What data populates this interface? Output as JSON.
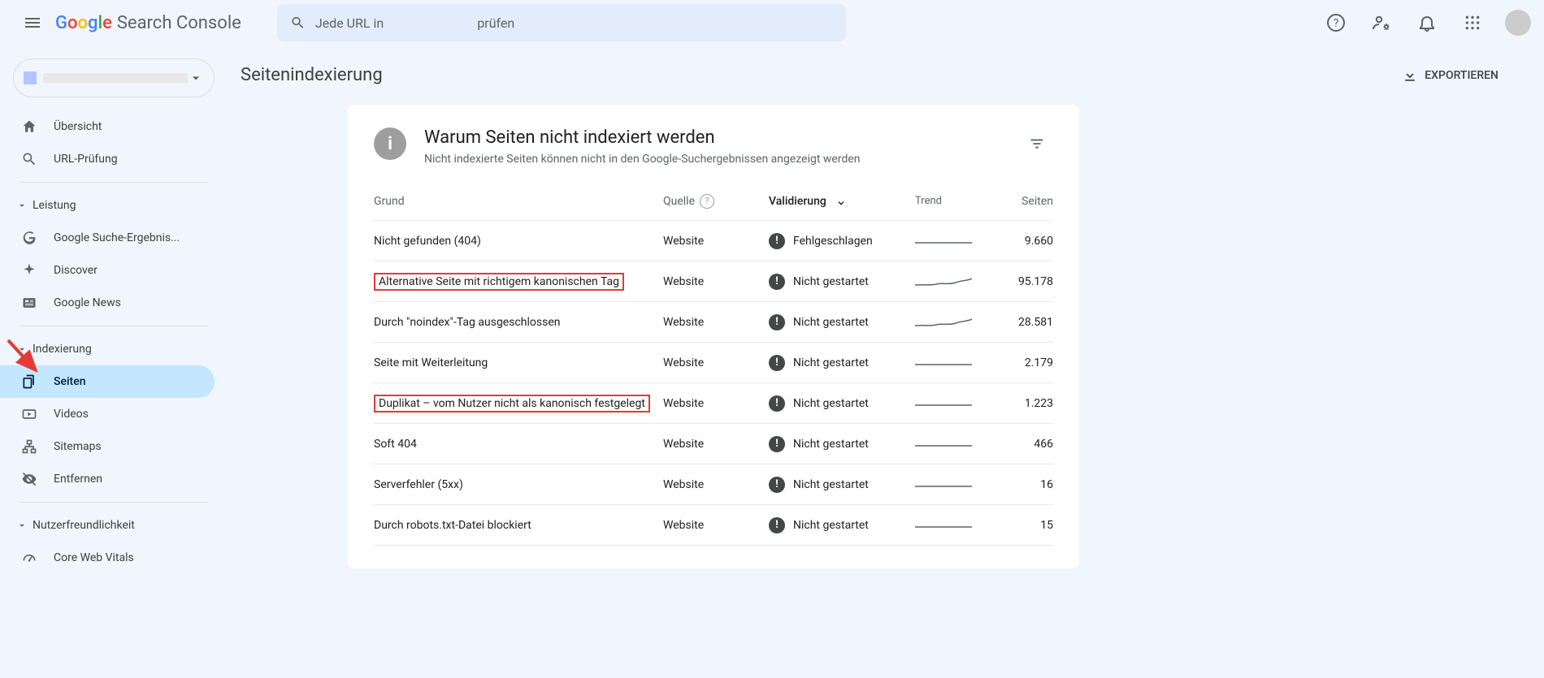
{
  "app": {
    "product_name": "Search Console"
  },
  "search": {
    "prefix": "Jede URL in",
    "suffix": "prüfen"
  },
  "sidebar": {
    "overview": "Übersicht",
    "url_inspection": "URL-Prüfung",
    "section_performance": "Leistung",
    "perf_search": "Google Suche-Ergebnis...",
    "perf_discover": "Discover",
    "perf_news": "Google News",
    "section_indexing": "Indexierung",
    "idx_pages": "Seiten",
    "idx_videos": "Videos",
    "idx_sitemaps": "Sitemaps",
    "idx_remove": "Entfernen",
    "section_ux": "Nutzerfreundlichkeit",
    "ux_cwv": "Core Web Vitals"
  },
  "page": {
    "title": "Seitenindexierung",
    "export": "EXPORTIEREN"
  },
  "card": {
    "title": "Warum Seiten nicht indexiert werden",
    "subtitle": "Nicht indexierte Seiten können nicht in den Google-Suchergebnissen angezeigt werden"
  },
  "table": {
    "head": {
      "reason": "Grund",
      "source": "Quelle",
      "validation": "Validierung",
      "trend": "Trend",
      "pages": "Seiten"
    },
    "rows": [
      {
        "reason": "Nicht gefunden (404)",
        "source": "Website",
        "validation": "Fehlgeschlagen",
        "pages": "9.660",
        "highlight": false,
        "trend": "flat"
      },
      {
        "reason": "Alternative Seite mit richtigem kanonischen Tag",
        "source": "Website",
        "validation": "Nicht gestartet",
        "pages": "95.178",
        "highlight": true,
        "trend": "wavy"
      },
      {
        "reason": "Durch \"noindex\"-Tag ausgeschlossen",
        "source": "Website",
        "validation": "Nicht gestartet",
        "pages": "28.581",
        "highlight": false,
        "trend": "wavy"
      },
      {
        "reason": "Seite mit Weiterleitung",
        "source": "Website",
        "validation": "Nicht gestartet",
        "pages": "2.179",
        "highlight": false,
        "trend": "flat"
      },
      {
        "reason": "Duplikat – vom Nutzer nicht als kanonisch festgelegt",
        "source": "Website",
        "validation": "Nicht gestartet",
        "pages": "1.223",
        "highlight": true,
        "trend": "flat"
      },
      {
        "reason": "Soft 404",
        "source": "Website",
        "validation": "Nicht gestartet",
        "pages": "466",
        "highlight": false,
        "trend": "flat"
      },
      {
        "reason": "Serverfehler (5xx)",
        "source": "Website",
        "validation": "Nicht gestartet",
        "pages": "16",
        "highlight": false,
        "trend": "flat"
      },
      {
        "reason": "Durch robots.txt-Datei blockiert",
        "source": "Website",
        "validation": "Nicht gestartet",
        "pages": "15",
        "highlight": false,
        "trend": "flat"
      }
    ]
  }
}
